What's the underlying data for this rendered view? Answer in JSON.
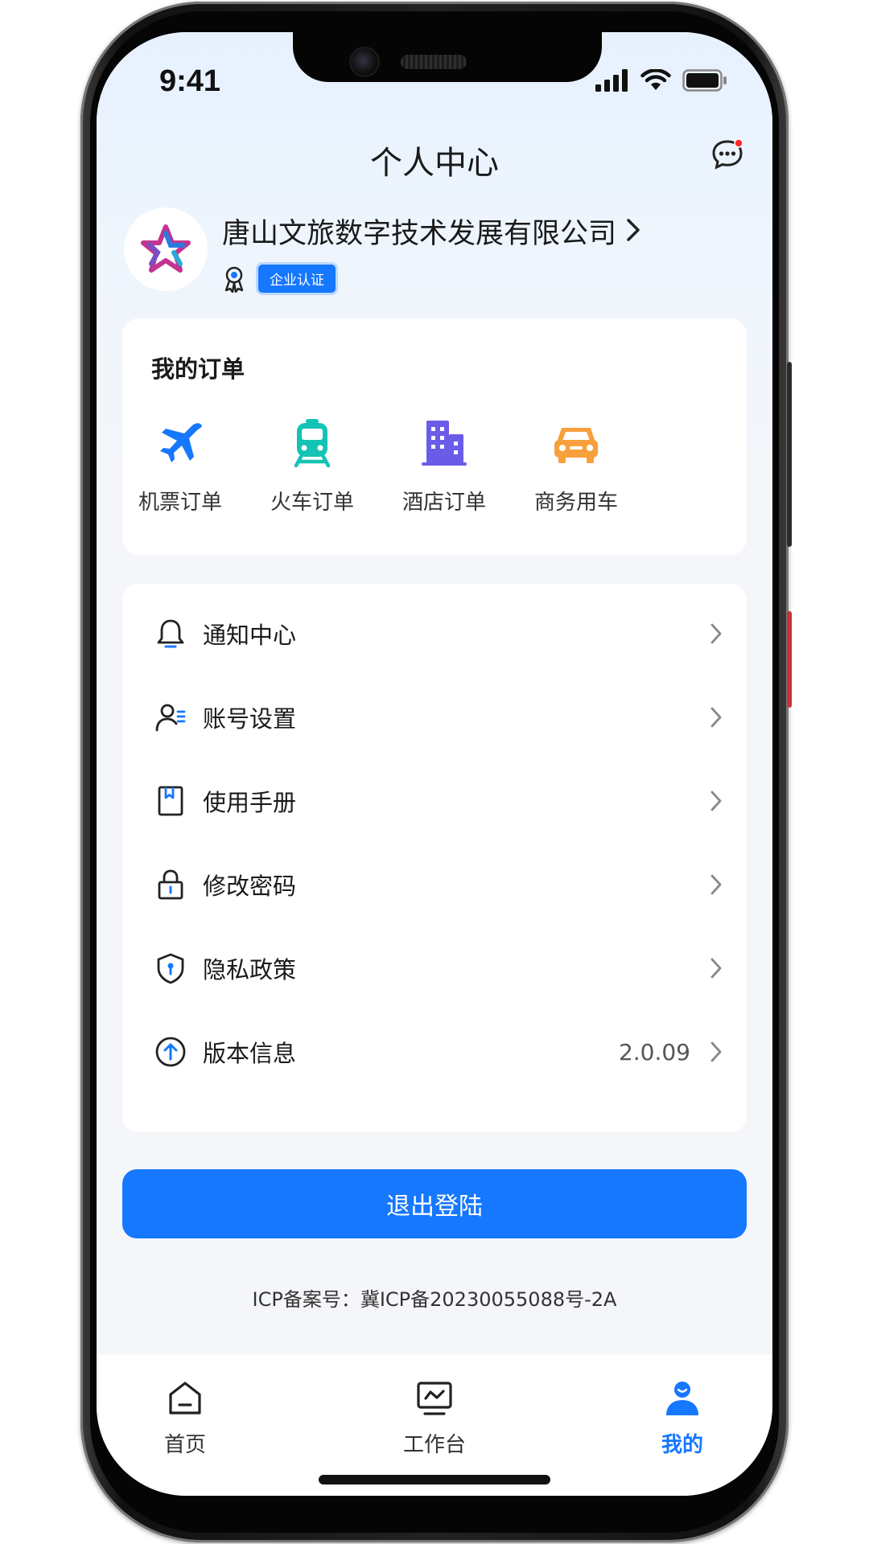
{
  "status_bar": {
    "time": "9:41"
  },
  "header": {
    "title": "个人中心",
    "message_icon": "chat-bubble-icon"
  },
  "company": {
    "name": "唐山文旅数字技术发展有限公司",
    "cert_label": "企业认证"
  },
  "orders": {
    "title": "我的订单",
    "items": [
      {
        "label": "机票订单",
        "icon": "airplane-icon",
        "color": "#1677ff"
      },
      {
        "label": "火车订单",
        "icon": "train-icon",
        "color": "#14c3b5"
      },
      {
        "label": "酒店订单",
        "icon": "hotel-building-icon",
        "color": "#6b5ce7"
      },
      {
        "label": "商务用车",
        "icon": "car-icon",
        "color": "#f7a03c"
      }
    ]
  },
  "menu": {
    "items": [
      {
        "label": "通知中心",
        "icon": "bell-icon",
        "value": ""
      },
      {
        "label": "账号设置",
        "icon": "user-settings-icon",
        "value": ""
      },
      {
        "label": "使用手册",
        "icon": "manual-book-icon",
        "value": ""
      },
      {
        "label": "修改密码",
        "icon": "lock-icon",
        "value": ""
      },
      {
        "label": "隐私政策",
        "icon": "shield-icon",
        "value": ""
      },
      {
        "label": "版本信息",
        "icon": "upgrade-arrow-icon",
        "value": "2.0.09"
      }
    ]
  },
  "logout": {
    "label": "退出登陆"
  },
  "footer": {
    "icp": "ICP备案号：冀ICP备20230055088号-2A"
  },
  "tabbar": {
    "items": [
      {
        "label": "首页",
        "icon": "home-icon",
        "active": false
      },
      {
        "label": "工作台",
        "icon": "workbench-monitor-icon",
        "active": false
      },
      {
        "label": "我的",
        "icon": "profile-person-icon",
        "active": true
      }
    ]
  },
  "colors": {
    "accent": "#1677ff",
    "notification_dot": "#ff2a2a"
  }
}
